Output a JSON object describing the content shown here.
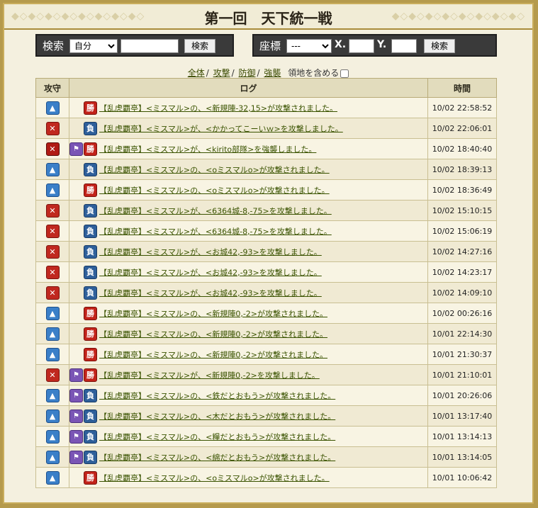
{
  "title": "第一回　天下統一戦",
  "search": {
    "label": "検索",
    "select_value": "自分",
    "input_value": "",
    "button": "検索"
  },
  "coords": {
    "label": "座標",
    "select_value": "---",
    "x_label": "X.",
    "x_value": "",
    "y_label": "Y.",
    "y_value": "",
    "button": "検索"
  },
  "filters": {
    "all": "全体",
    "attack": "攻撃",
    "defense": "防御",
    "raid": "強襲",
    "territory_label": "領地を含める"
  },
  "table": {
    "headers": [
      "攻守",
      "ログ",
      "時間"
    ],
    "rows": [
      {
        "type": "def",
        "flag": false,
        "result": "勝",
        "text": "【乱虎覇亭】<ミスマル>の、<新規陣-32,15>が攻撃されました。",
        "time": "10/02 22:58:52"
      },
      {
        "type": "att",
        "flag": false,
        "result": "負",
        "text": "【乱虎覇亭】<ミスマル>が、<かかってこーいｗ>を攻撃しました。",
        "time": "10/02 22:06:01"
      },
      {
        "type": "raid",
        "flag": true,
        "result": "勝",
        "text": "【乱虎覇亭】<ミスマル>が、<kirito部隊>を強襲しました。",
        "time": "10/02 18:40:40"
      },
      {
        "type": "def",
        "flag": false,
        "result": "負",
        "text": "【乱虎覇亭】<ミスマル>の、<oミスマルo>が攻撃されました。",
        "time": "10/02 18:39:13"
      },
      {
        "type": "def",
        "flag": false,
        "result": "勝",
        "text": "【乱虎覇亭】<ミスマル>の、<oミスマルo>が攻撃されました。",
        "time": "10/02 18:36:49"
      },
      {
        "type": "att",
        "flag": false,
        "result": "負",
        "text": "【乱虎覇亭】<ミスマル>が、<6364城-8,-75>を攻撃しました。",
        "time": "10/02 15:10:15"
      },
      {
        "type": "att",
        "flag": false,
        "result": "負",
        "text": "【乱虎覇亭】<ミスマル>が、<6364城-8,-75>を攻撃しました。",
        "time": "10/02 15:06:19"
      },
      {
        "type": "att",
        "flag": false,
        "result": "負",
        "text": "【乱虎覇亭】<ミスマル>が、<お城42,-93>を攻撃しました。",
        "time": "10/02 14:27:16"
      },
      {
        "type": "att",
        "flag": false,
        "result": "負",
        "text": "【乱虎覇亭】<ミスマル>が、<お城42,-93>を攻撃しました。",
        "time": "10/02 14:23:17"
      },
      {
        "type": "att",
        "flag": false,
        "result": "負",
        "text": "【乱虎覇亭】<ミスマル>が、<お城42,-93>を攻撃しました。",
        "time": "10/02 14:09:10"
      },
      {
        "type": "def",
        "flag": false,
        "result": "勝",
        "text": "【乱虎覇亭】<ミスマル>の、<新規陣0,-2>が攻撃されました。",
        "time": "10/02 00:26:16"
      },
      {
        "type": "def",
        "flag": false,
        "result": "勝",
        "text": "【乱虎覇亭】<ミスマル>の、<新規陣0,-2>が攻撃されました。",
        "time": "10/01 22:14:30"
      },
      {
        "type": "def",
        "flag": false,
        "result": "勝",
        "text": "【乱虎覇亭】<ミスマル>の、<新規陣0,-2>が攻撃されました。",
        "time": "10/01 21:30:37"
      },
      {
        "type": "att",
        "flag": true,
        "result": "勝",
        "text": "【乱虎覇亭】<ミスマル>が、<新規陣0,-2>を攻撃しました。",
        "time": "10/01 21:10:01"
      },
      {
        "type": "def",
        "flag": true,
        "result": "負",
        "text": "【乱虎覇亭】<ミスマル>の、<鉄だとおもう>が攻撃されました。",
        "time": "10/01 20:26:06"
      },
      {
        "type": "def",
        "flag": true,
        "result": "負",
        "text": "【乱虎覇亭】<ミスマル>の、<木だとおもう>が攻撃されました。",
        "time": "10/01 13:17:40"
      },
      {
        "type": "def",
        "flag": true,
        "result": "負",
        "text": "【乱虎覇亭】<ミスマル>の、<糧だとおもう>が攻撃されました。",
        "time": "10/01 13:14:13"
      },
      {
        "type": "def",
        "flag": true,
        "result": "負",
        "text": "【乱虎覇亭】<ミスマル>の、<綿だとおもう>が攻撃されました。",
        "time": "10/01 13:14:05"
      },
      {
        "type": "def",
        "flag": false,
        "result": "勝",
        "text": "【乱虎覇亭】<ミスマル>の、<oミスマルo>が攻撃されました。",
        "time": "10/01 10:06:42"
      }
    ]
  },
  "icons": {
    "def": "defense-icon",
    "att": "attack-icon",
    "raid": "raid-icon",
    "flag": "flag-icon"
  },
  "colors": {
    "win": "#c2231a",
    "lose": "#2e5f9a",
    "link": "#3a5300"
  }
}
